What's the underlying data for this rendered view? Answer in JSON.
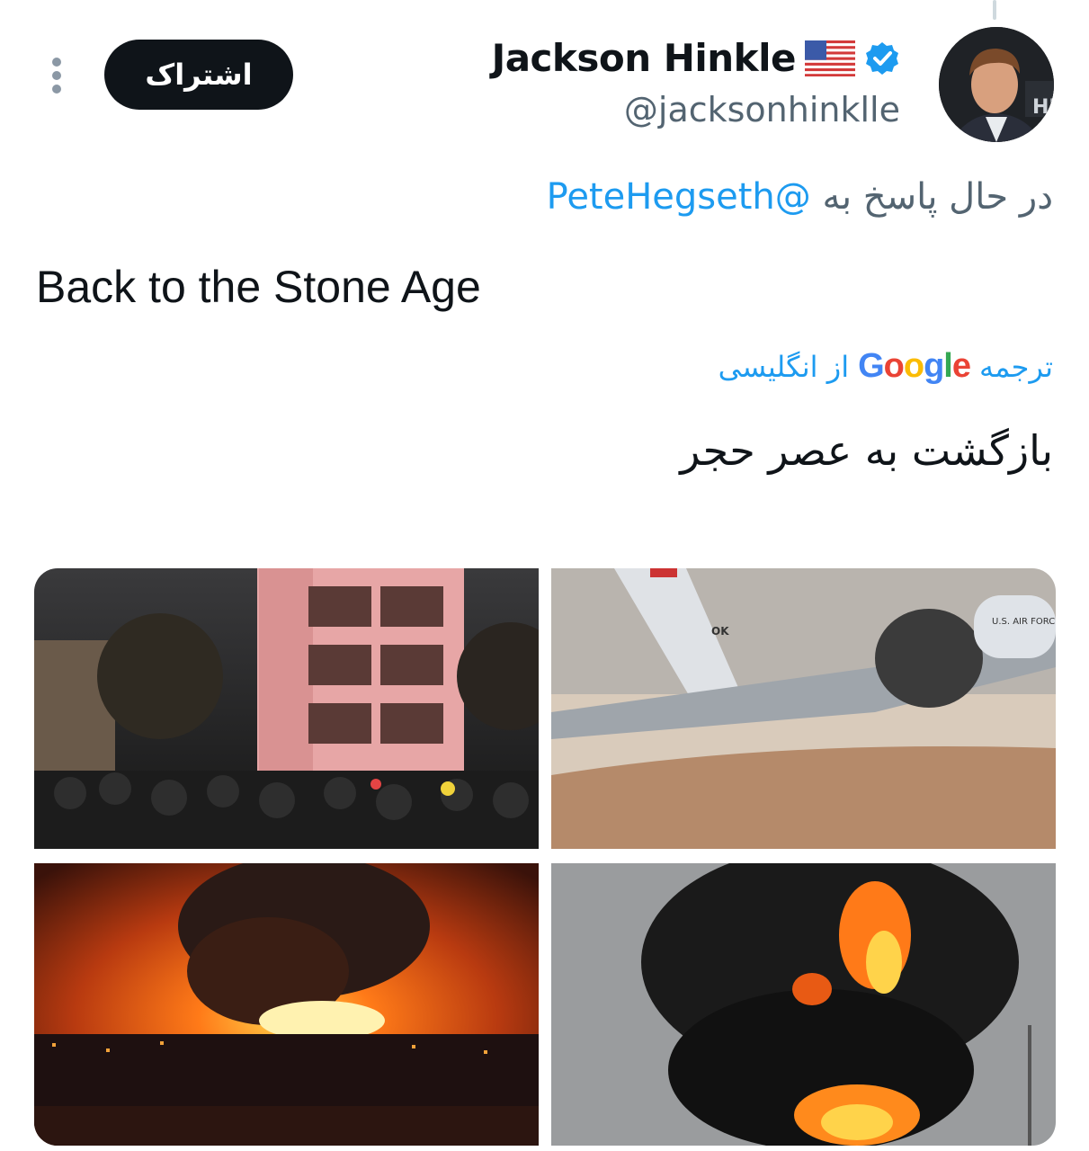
{
  "author": {
    "name": "Jackson Hinkle",
    "flag": "🇺🇸",
    "handle": "@jacksonhinklle",
    "verified_icon": "verified-badge-icon"
  },
  "actions": {
    "follow_label": "اشتراک",
    "more_icon": "more-vertical-icon"
  },
  "reply": {
    "prefix": "در حال پاسخ به",
    "mention": "@PeteHegseth"
  },
  "tweet": {
    "text": "Back to the Stone Age"
  },
  "translation": {
    "prefix": "ترجمه",
    "service": "Google",
    "suffix": "از انگلیسی",
    "text": "بازگشت به عصر حجر"
  },
  "media": {
    "tiles": [
      {
        "alt": "damaged-building-crowd-night"
      },
      {
        "alt": "wrecked-military-aircraft",
        "tail_text": "OK",
        "fuselage_text": "U.S. AIR FORC"
      },
      {
        "alt": "refinery-fire-night"
      },
      {
        "alt": "black-smoke-fire-day"
      }
    ]
  },
  "colors": {
    "accent": "#1d9bf0",
    "text": "#0f1419",
    "muted": "#536471"
  }
}
